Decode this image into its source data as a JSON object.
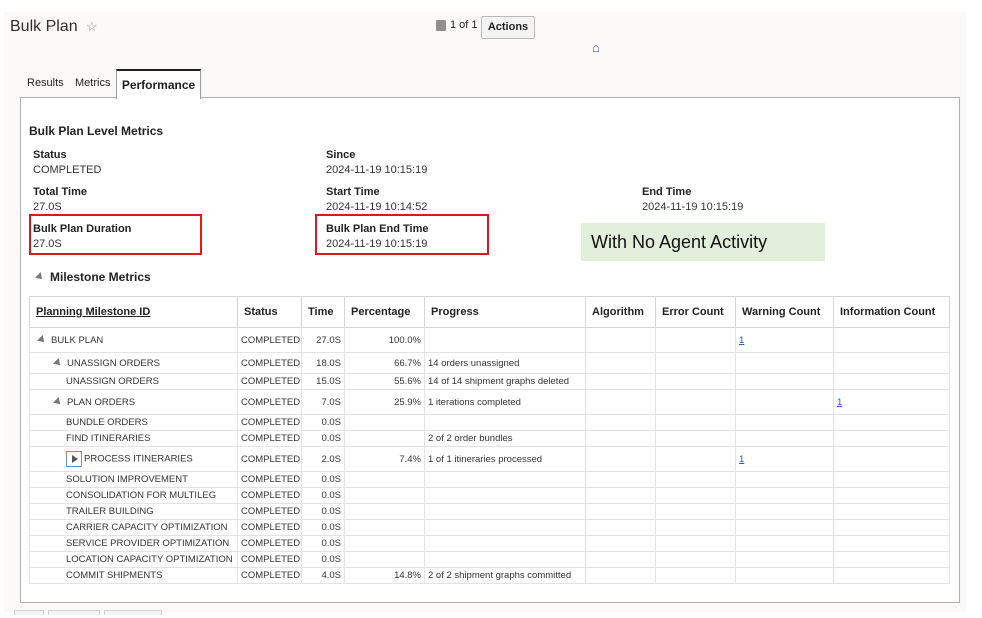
{
  "header": {
    "title": "Bulk Plan",
    "star_icon": "star-icon",
    "pager_text": "1 of 1",
    "actions_label": "Actions",
    "glyph": "⌂"
  },
  "tabs": [
    {
      "label": "Results"
    },
    {
      "label": "Metrics"
    },
    {
      "label": "Performance",
      "active": true
    }
  ],
  "level_metrics": {
    "title": "Bulk Plan Level Metrics",
    "status_label": "Status",
    "status_value": "COMPLETED",
    "since_label": "Since",
    "since_value": "2024-11-19 10:15:19",
    "total_time_label": "Total Time",
    "total_time_value": "27.0S",
    "start_time_label": "Start Time",
    "start_time_value": "2024-11-19 10:14:52",
    "end_time_label": "End Time",
    "end_time_value": "2024-11-19 10:15:19",
    "duration_label": "Bulk Plan Duration",
    "duration_value": "27.0S",
    "plan_end_label": "Bulk Plan End Time",
    "plan_end_value": "2024-11-19 10:15:19"
  },
  "callout": "With No Agent Activity",
  "milestones": {
    "title": "Milestone Metrics",
    "columns": [
      "Planning Milestone ID",
      "Status",
      "Time",
      "Percentage",
      "Progress",
      "Algorithm",
      "Error Count",
      "Warning Count",
      "Information Count"
    ],
    "rows": [
      {
        "id": "BULK PLAN",
        "status": "COMPLETED",
        "time": "27.0S",
        "pct": "100.0%",
        "progress": "",
        "warning": "1",
        "info": ""
      },
      {
        "id": "UNASSIGN ORDERS",
        "status": "COMPLETED",
        "time": "18.0S",
        "pct": "66.7%",
        "progress": "14 orders unassigned",
        "warning": "",
        "info": ""
      },
      {
        "id": "UNASSIGN ORDERS",
        "status": "COMPLETED",
        "time": "15.0S",
        "pct": "55.6%",
        "progress": "14 of 14 shipment graphs deleted",
        "warning": "",
        "info": ""
      },
      {
        "id": "PLAN ORDERS",
        "status": "COMPLETED",
        "time": "7.0S",
        "pct": "25.9%",
        "progress": "1 iterations completed",
        "warning": "",
        "info": "1"
      },
      {
        "id": "BUNDLE ORDERS",
        "status": "COMPLETED",
        "time": "0.0S",
        "pct": "",
        "progress": "",
        "warning": "",
        "info": ""
      },
      {
        "id": "FIND ITINERARIES",
        "status": "COMPLETED",
        "time": "0.0S",
        "pct": "",
        "progress": "2 of 2 order bundles",
        "warning": "",
        "info": ""
      },
      {
        "id": "PROCESS ITINERARIES",
        "status": "COMPLETED",
        "time": "2.0S",
        "pct": "7.4%",
        "progress": "1 of 1 itineraries processed",
        "warning": "1",
        "info": ""
      },
      {
        "id": "SOLUTION IMPROVEMENT",
        "status": "COMPLETED",
        "time": "0.0S",
        "pct": "",
        "progress": "",
        "warning": "",
        "info": ""
      },
      {
        "id": "CONSOLIDATION FOR MULTILEG",
        "status": "COMPLETED",
        "time": "0.0S",
        "pct": "",
        "progress": "",
        "warning": "",
        "info": ""
      },
      {
        "id": "TRAILER BUILDING",
        "status": "COMPLETED",
        "time": "0.0S",
        "pct": "",
        "progress": "",
        "warning": "",
        "info": ""
      },
      {
        "id": "CARRIER CAPACITY OPTIMIZATION",
        "status": "COMPLETED",
        "time": "0.0S",
        "pct": "",
        "progress": "",
        "warning": "",
        "info": ""
      },
      {
        "id": "SERVICE PROVIDER OPTIMIZATION",
        "status": "COMPLETED",
        "time": "0.0S",
        "pct": "",
        "progress": "",
        "warning": "",
        "info": ""
      },
      {
        "id": "LOCATION CAPACITY OPTIMIZATION",
        "status": "COMPLETED",
        "time": "0.0S",
        "pct": "",
        "progress": "",
        "warning": "",
        "info": ""
      },
      {
        "id": "COMMIT SHIPMENTS",
        "status": "COMPLETED",
        "time": "4.0S",
        "pct": "14.8%",
        "progress": "2 of 2 shipment graphs committed",
        "warning": "",
        "info": ""
      }
    ]
  }
}
